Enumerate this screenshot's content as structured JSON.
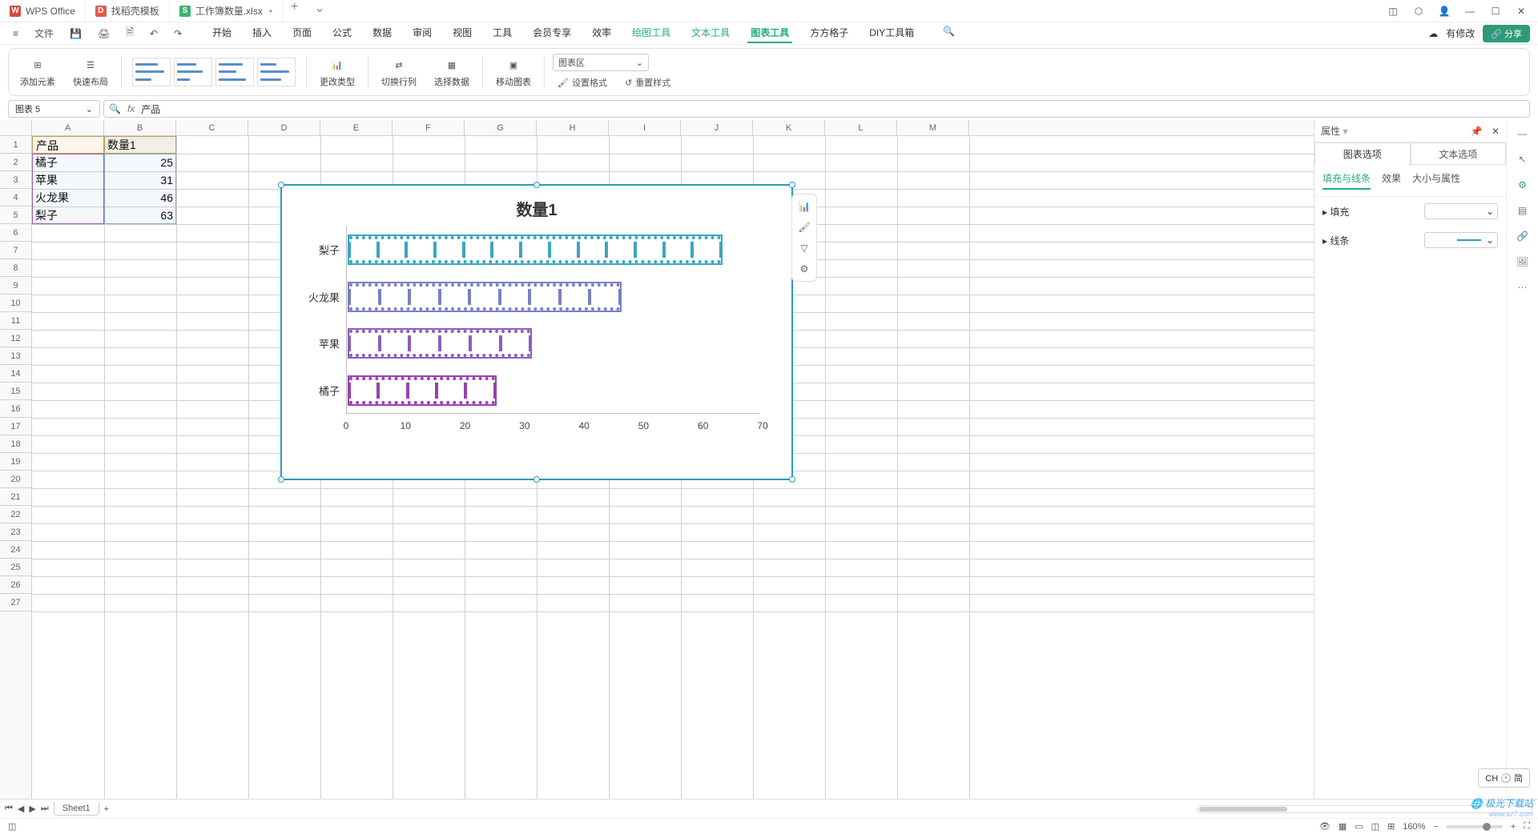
{
  "tabs": [
    {
      "icon_bg": "#d84a3b",
      "icon_text": "W",
      "label": "WPS Office"
    },
    {
      "icon_bg": "#e05a4a",
      "icon_text": "D",
      "label": "找稻壳模板"
    },
    {
      "icon_bg": "#3cb271",
      "icon_text": "S",
      "label": "工作簿数量.xlsx",
      "dirty": "•"
    }
  ],
  "menubar": {
    "file": "文件"
  },
  "ribbon_tabs": [
    "开始",
    "插入",
    "页面",
    "公式",
    "数据",
    "审阅",
    "视图",
    "工具",
    "会员专享",
    "效率"
  ],
  "ribbon_tools": [
    "绘图工具",
    "文本工具",
    "图表工具",
    "方方格子",
    "DIY工具箱"
  ],
  "ribbon_active": "图表工具",
  "modify": "有修改",
  "share": "分享",
  "ribbon": {
    "add": "添加元素",
    "quick": "快速布局",
    "change": "更改类型",
    "swap": "切换行列",
    "select": "选择数据",
    "move": "移动图表",
    "area": "图表区",
    "fmt": "设置格式",
    "reset": "重置样式"
  },
  "namebox": "图表 5",
  "formula": "产品",
  "columns": [
    "A",
    "B",
    "C",
    "D",
    "E",
    "F",
    "G",
    "H",
    "I",
    "J",
    "K",
    "L",
    "M"
  ],
  "rows": 27,
  "cells": {
    "A1": "产品",
    "B1": "数量1",
    "A2": "橘子",
    "B2": "25",
    "A3": "苹果",
    "B3": "31",
    "A4": "火龙果",
    "B4": "46",
    "A5": "梨子",
    "B5": "63"
  },
  "chart_data": {
    "type": "bar",
    "title": "数量1",
    "categories": [
      "梨子",
      "火龙果",
      "苹果",
      "橘子"
    ],
    "values": [
      63,
      46,
      31,
      25
    ],
    "colors": [
      "#3aa6c4",
      "#7a7fc5",
      "#8a5fb8",
      "#9a3fb0"
    ],
    "xticks": [
      0,
      10,
      20,
      30,
      40,
      50,
      60,
      70
    ],
    "xlim": [
      0,
      70
    ]
  },
  "panel": {
    "title": "属性",
    "tab1": "图表选项",
    "tab2": "文本选项",
    "sub1": "填充与线条",
    "sub2": "效果",
    "sub3": "大小与属性",
    "fill": "填充",
    "line": "线条",
    "line_color": "#2e9abf"
  },
  "sheettab": "Sheet1",
  "status": {
    "zoom": "160%",
    "ime": "CH 🕐 简"
  },
  "watermark": {
    "main": "极光下载站",
    "sub": "www.xz7.com"
  }
}
